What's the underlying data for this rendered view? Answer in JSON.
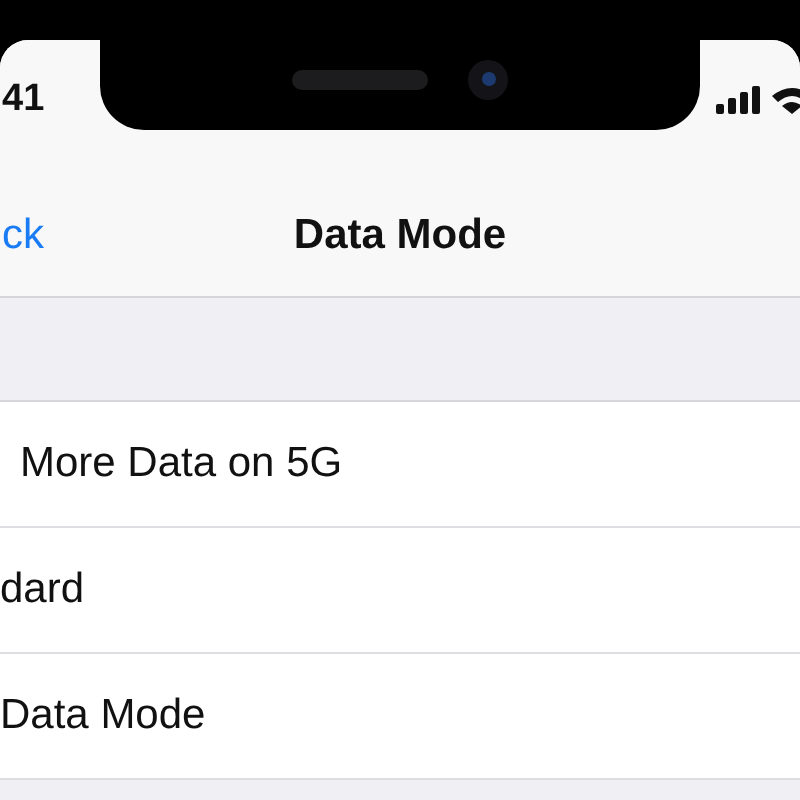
{
  "status_bar": {
    "time": "41"
  },
  "nav_bar": {
    "back": "ck",
    "title": "Data Mode"
  },
  "options": [
    {
      "label": "More Data on 5G"
    },
    {
      "label": "dard"
    },
    {
      "label": "Data Mode"
    }
  ]
}
